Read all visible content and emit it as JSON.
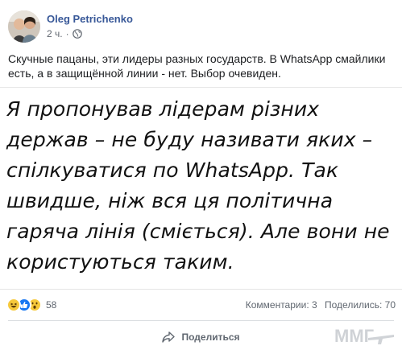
{
  "post": {
    "author": "Oleg Petrichenko",
    "time": "2 ч.",
    "separator": "·",
    "privacy_icon": "globe-icon",
    "caption": "Скучные пацаны, эти лидеры разных государств. В WhatsApp смайлики есть, а в защищённой линии - нет. Выбор очевиден.",
    "quote": "Я пропонував лідерам різних держав – не буду називати яких – спілкуватися по WhatsApp. Так швидше, ніж вся ця політична гаряча лінія (сміється). Але вони не користуються таким."
  },
  "stats": {
    "reaction_icons": [
      "haha-icon",
      "like-icon",
      "wow-icon"
    ],
    "reactions_count": "58",
    "comments": "Комментарии: 3",
    "shares": "Поделились: 70"
  },
  "actions": {
    "share_label": "Поделиться",
    "share_icon": "share-arrow-icon"
  },
  "watermark": {
    "text": "ММГ"
  },
  "colors": {
    "author": "#385898",
    "meta_text": "#616770",
    "like_blue": "#1877f2",
    "emoji_yellow": "#f7c93b"
  }
}
